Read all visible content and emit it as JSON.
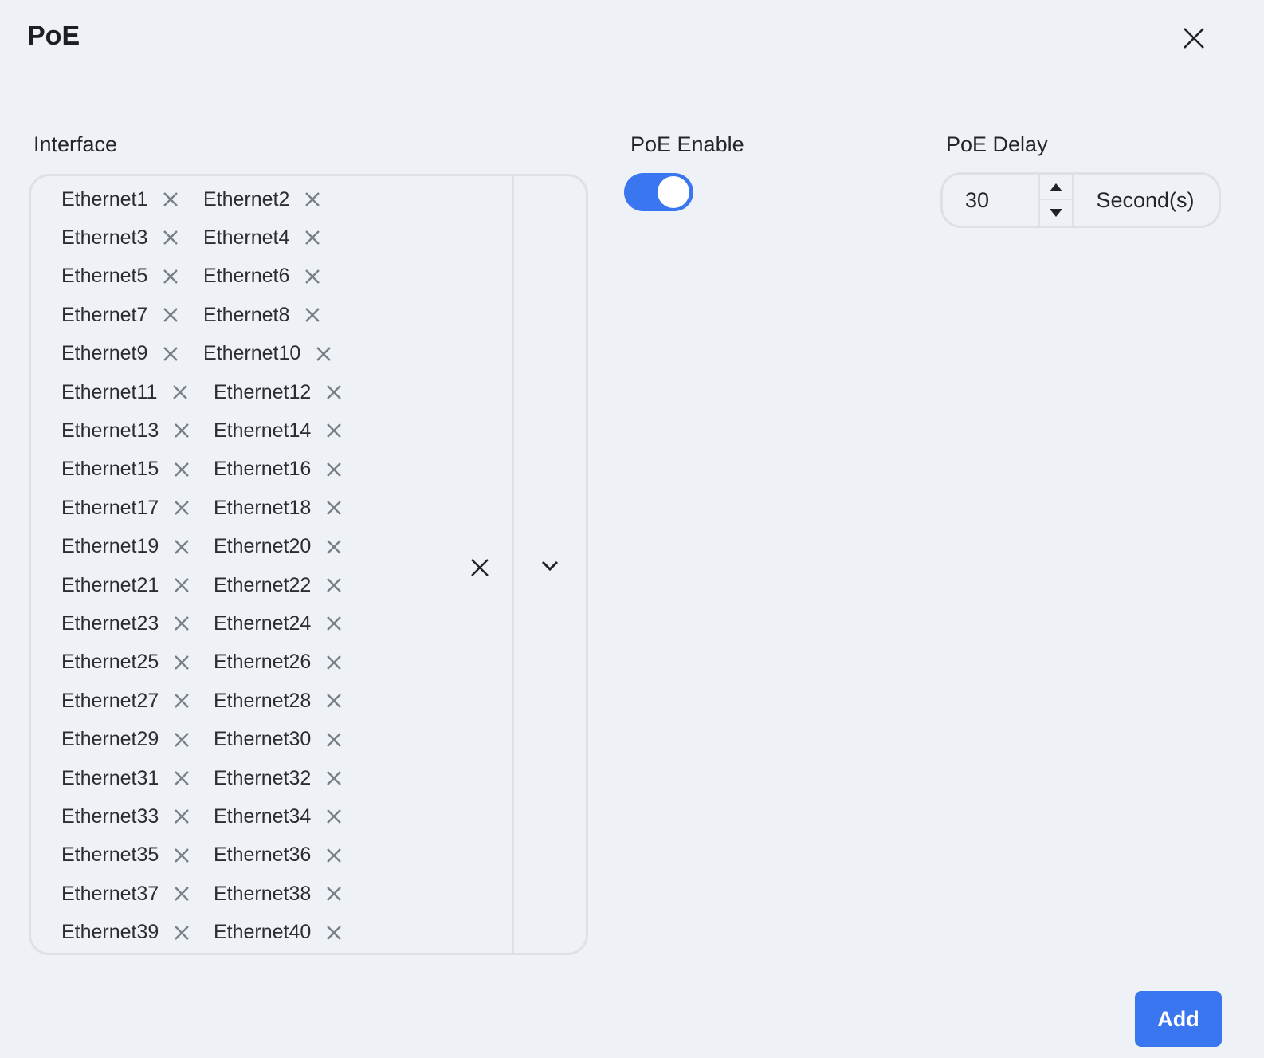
{
  "dialog": {
    "title": "PoE"
  },
  "interface": {
    "label": "Interface",
    "selected": [
      "Ethernet1",
      "Ethernet2",
      "Ethernet3",
      "Ethernet4",
      "Ethernet5",
      "Ethernet6",
      "Ethernet7",
      "Ethernet8",
      "Ethernet9",
      "Ethernet10",
      "Ethernet11",
      "Ethernet12",
      "Ethernet13",
      "Ethernet14",
      "Ethernet15",
      "Ethernet16",
      "Ethernet17",
      "Ethernet18",
      "Ethernet19",
      "Ethernet20",
      "Ethernet21",
      "Ethernet22",
      "Ethernet23",
      "Ethernet24",
      "Ethernet25",
      "Ethernet26",
      "Ethernet27",
      "Ethernet28",
      "Ethernet29",
      "Ethernet30",
      "Ethernet31",
      "Ethernet32",
      "Ethernet33",
      "Ethernet34",
      "Ethernet35",
      "Ethernet36",
      "Ethernet37",
      "Ethernet38",
      "Ethernet39",
      "Ethernet40"
    ]
  },
  "poe_enable": {
    "label": "PoE Enable",
    "value": true
  },
  "poe_delay": {
    "label": "PoE Delay",
    "value": "30",
    "unit": "Second(s)"
  },
  "actions": {
    "add_label": "Add"
  },
  "colors": {
    "accent": "#3a76ef",
    "background": "#eef1f6",
    "border": "#dde1e7"
  },
  "icons": {
    "close": "close-icon",
    "chip_remove": "x-icon",
    "dropdown": "chevron-down-icon",
    "step_up": "triangle-up-icon",
    "step_down": "triangle-down-icon"
  }
}
